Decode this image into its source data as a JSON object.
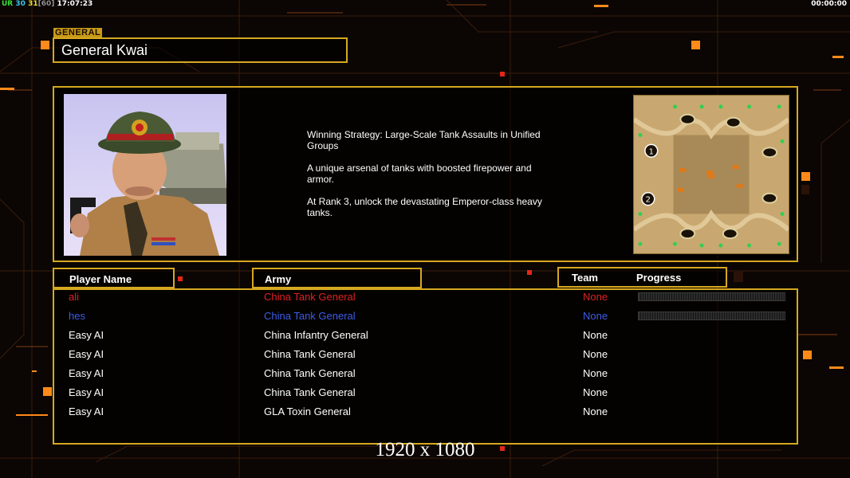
{
  "hud": {
    "fps_a": "UR",
    "fps_b": "30",
    "fps_c": "31",
    "fps_limit": "[60]",
    "clock": "17:07:23",
    "timer": "00:00:00"
  },
  "general": {
    "tag": "GENERAL",
    "name": "General Kwai"
  },
  "description": [
    "Winning Strategy: Large-Scale Tank Assaults in Unified\n Groups",
    "A unique arsenal of tanks with boosted firepower and\n armor.",
    "At Rank 3, unlock the devastating Emperor-class heavy\n tanks."
  ],
  "minimap": {
    "start_positions": [
      "1",
      "2"
    ]
  },
  "headers": {
    "player": "Player Name",
    "army": "Army",
    "team": "Team",
    "progress": "Progress"
  },
  "players": [
    {
      "name": "ali",
      "army": "China Tank General",
      "team": "None",
      "color": "#e02020",
      "progress": 0
    },
    {
      "name": "hes",
      "army": "China Tank General",
      "team": "None",
      "color": "#3c5ce8",
      "progress": 0
    },
    {
      "name": "Easy AI",
      "army": "China Infantry General",
      "team": "None",
      "color": "#ffffff"
    },
    {
      "name": "Easy AI",
      "army": "China Tank General",
      "team": "None",
      "color": "#ffffff"
    },
    {
      "name": "Easy AI",
      "army": "China Tank General",
      "team": "None",
      "color": "#ffffff"
    },
    {
      "name": "Easy AI",
      "army": "China Tank General",
      "team": "None",
      "color": "#ffffff"
    },
    {
      "name": "Easy AI",
      "army": "GLA Toxin General",
      "team": "None",
      "color": "#ffffff"
    }
  ],
  "resolution_label": "1920 x 1080",
  "colors": {
    "frame": "#d6a820",
    "accent": "#ff8a1a"
  }
}
